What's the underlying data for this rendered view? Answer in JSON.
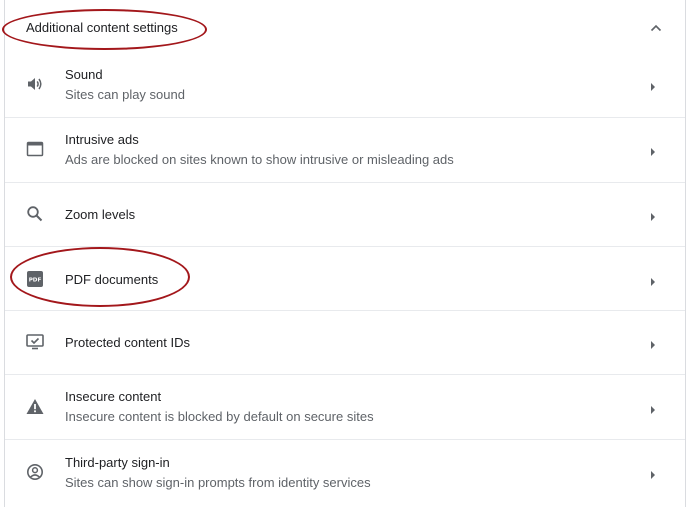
{
  "section": {
    "title": "Additional content settings",
    "expanded": true,
    "toggle_icon": "chevron-up-icon"
  },
  "items": [
    {
      "id": "sound",
      "icon": "volume-icon",
      "title": "Sound",
      "subtitle": "Sites can play sound"
    },
    {
      "id": "intrusive-ads",
      "icon": "window-icon",
      "title": "Intrusive ads",
      "subtitle": "Ads are blocked on sites known to show intrusive or misleading ads"
    },
    {
      "id": "zoom-levels",
      "icon": "search-icon",
      "title": "Zoom levels",
      "subtitle": ""
    },
    {
      "id": "pdf-documents",
      "icon": "pdf-icon",
      "title": "PDF documents",
      "subtitle": ""
    },
    {
      "id": "protected-content",
      "icon": "monitor-check-icon",
      "title": "Protected content IDs",
      "subtitle": ""
    },
    {
      "id": "insecure-content",
      "icon": "warning-icon",
      "title": "Insecure content",
      "subtitle": "Insecure content is blocked by default on secure sites"
    },
    {
      "id": "third-party-sign-in",
      "icon": "account-circle-icon",
      "title": "Third-party sign-in",
      "subtitle": "Sites can show sign-in prompts from identity services"
    }
  ],
  "colors": {
    "annotation": "#a3171b",
    "icon": "#5f6368",
    "text_primary": "#202124",
    "text_secondary": "#5f6368",
    "divider": "#e8eaed"
  }
}
